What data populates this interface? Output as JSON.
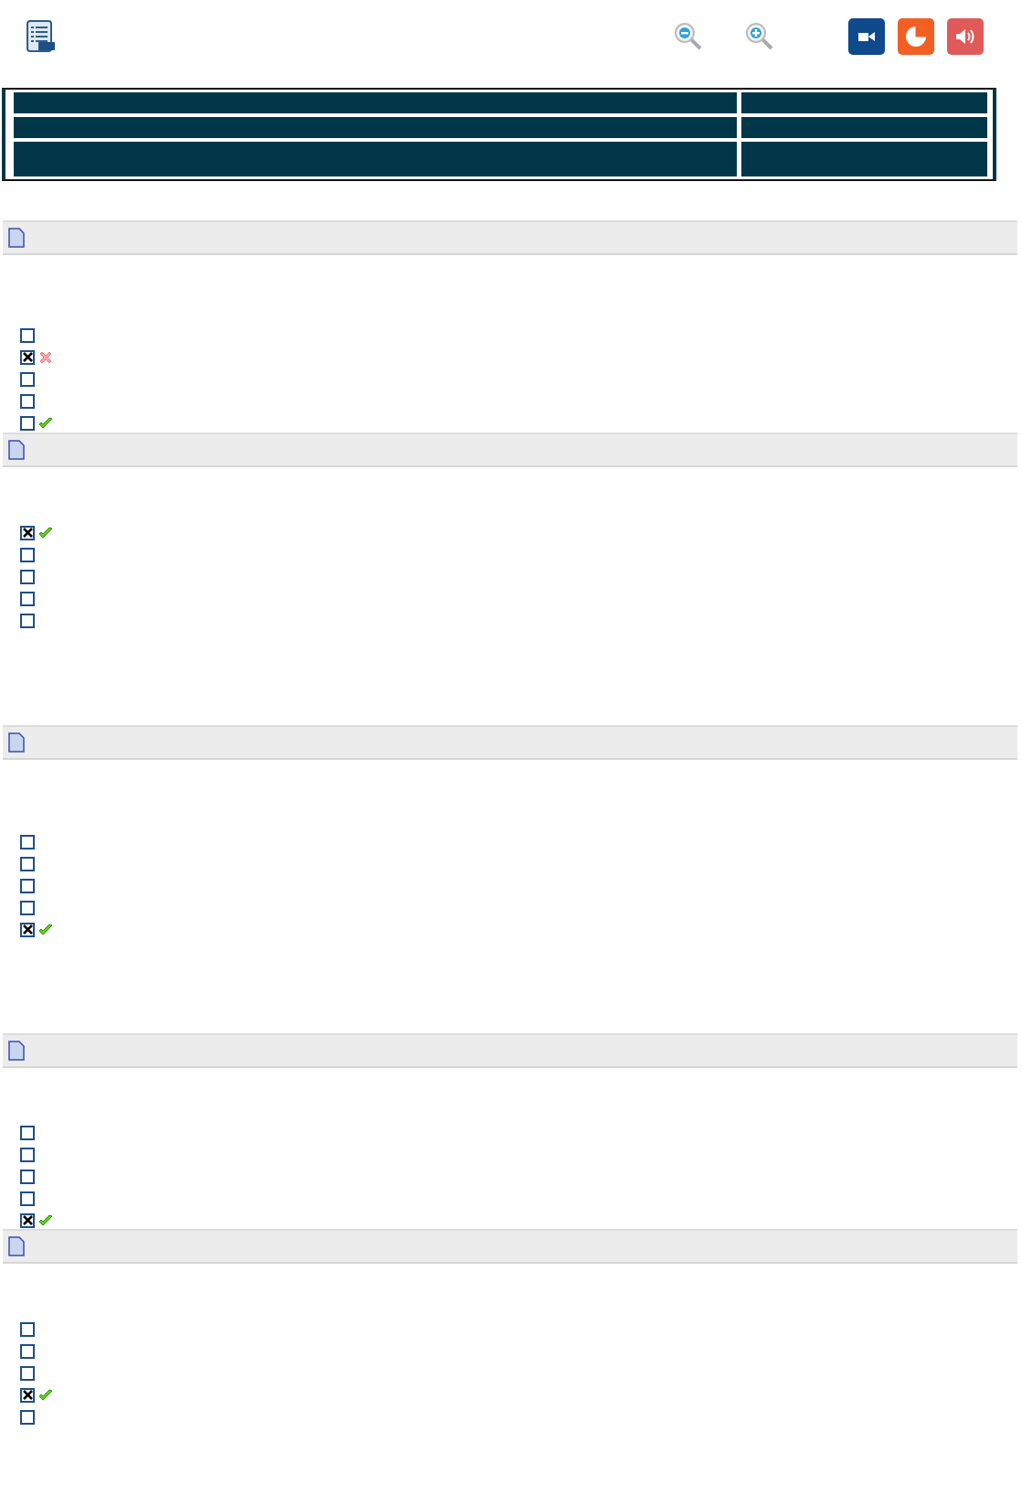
{
  "sections": [
    {
      "options": [
        {
          "checked": false
        },
        {
          "checked": true,
          "correct": false
        },
        {
          "checked": false
        },
        {
          "checked": false
        },
        {
          "checked": false,
          "correct": true
        }
      ]
    },
    {
      "options": [
        {
          "checked": true,
          "correct": true
        },
        {
          "checked": false
        },
        {
          "checked": false
        },
        {
          "checked": false
        },
        {
          "checked": false
        }
      ]
    },
    {
      "options": [
        {
          "checked": false
        },
        {
          "checked": false
        },
        {
          "checked": false
        },
        {
          "checked": false
        },
        {
          "checked": true,
          "correct": true
        }
      ]
    },
    {
      "options": [
        {
          "checked": false
        },
        {
          "checked": false
        },
        {
          "checked": false
        },
        {
          "checked": false
        },
        {
          "checked": true,
          "correct": true
        }
      ]
    },
    {
      "options": [
        {
          "checked": false
        },
        {
          "checked": false
        },
        {
          "checked": false
        },
        {
          "checked": true,
          "correct": true
        },
        {
          "checked": false
        }
      ]
    }
  ]
}
